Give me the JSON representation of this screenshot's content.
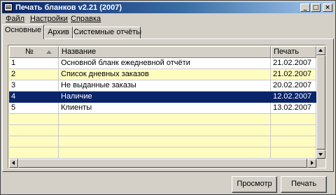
{
  "window": {
    "title": "Печать бланков v2.21 (2007)",
    "controls": {
      "minimize": "_",
      "maximize": "□",
      "close": "×"
    }
  },
  "menu": [
    "Файл",
    "Настройки",
    "Справка"
  ],
  "tabs": [
    {
      "label": "Основные",
      "active": true
    },
    {
      "label": "Архив",
      "active": false
    },
    {
      "label": "Системные отчёты",
      "active": false
    }
  ],
  "table": {
    "columns": [
      "№",
      "Название",
      "Печать"
    ],
    "rows": [
      {
        "num": "1",
        "name": "Основной бланк ежедневной отчёти",
        "date": "21.02.2007"
      },
      {
        "num": "2",
        "name": "Список дневных заказов",
        "date": "21.02.2007"
      },
      {
        "num": "3",
        "name": "Не выданные заказы",
        "date": "20.02.2007"
      },
      {
        "num": "4",
        "name": "Наличие",
        "date": "12.02.2007"
      },
      {
        "num": "5",
        "name": "Клиенты",
        "date": "13.02.2007"
      }
    ],
    "selected_row": 4
  },
  "buttons": {
    "preview": "Просмотр",
    "print": "Печать"
  },
  "colors": {
    "title_gradient_start": "#0a246a",
    "selection": "#0a246a",
    "row_yellow": "#fffcc0",
    "face": "#d4d0c8"
  }
}
